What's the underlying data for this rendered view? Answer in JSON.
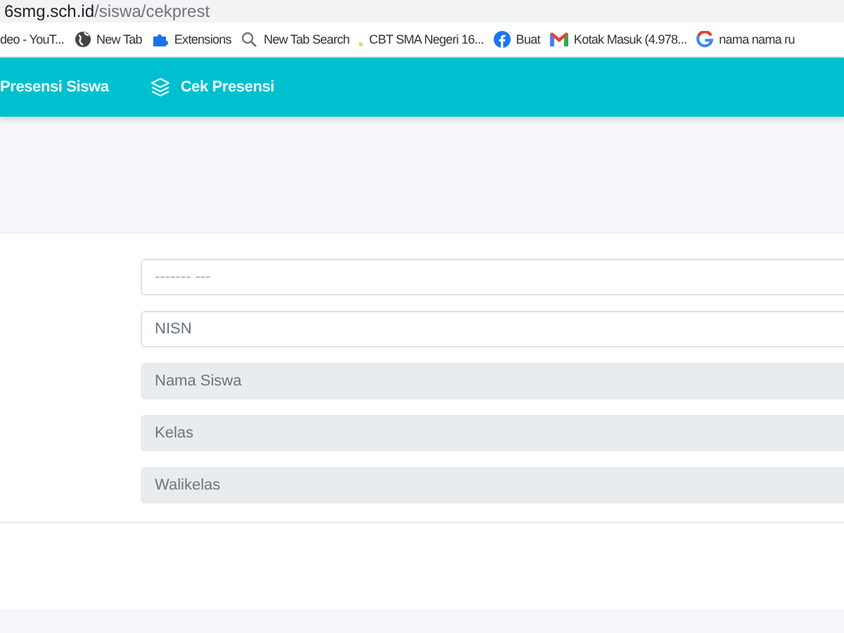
{
  "address_bar": {
    "url_host": "6smg.sch.id",
    "url_path": "/siswa/cekprest"
  },
  "bookmarks": [
    {
      "label": "deo - YouT...",
      "kind": "none"
    },
    {
      "label": "New Tab",
      "kind": "globe"
    },
    {
      "label": "Extensions",
      "kind": "puzzle"
    },
    {
      "label": "New Tab Search",
      "kind": "search"
    },
    {
      "label": "CBT SMA Negeri 16...",
      "kind": "dot"
    },
    {
      "label": "Buat",
      "kind": "facebook"
    },
    {
      "label": "Kotak Masuk (4.978...",
      "kind": "mail"
    },
    {
      "label": "nama nama ru",
      "kind": "google"
    }
  ],
  "nav": [
    {
      "label": "Presensi Siswa",
      "kind": "text"
    },
    {
      "label": "Cek Presensi",
      "kind": "layers"
    }
  ],
  "form": {
    "fields": [
      {
        "placeholder": "------- ---",
        "disabled": false
      },
      {
        "placeholder": "NISN",
        "disabled": false
      },
      {
        "placeholder": "Nama Siswa",
        "disabled": true
      },
      {
        "placeholder": "Kelas",
        "disabled": true
      },
      {
        "placeholder": "Walikelas",
        "disabled": true
      }
    ]
  }
}
